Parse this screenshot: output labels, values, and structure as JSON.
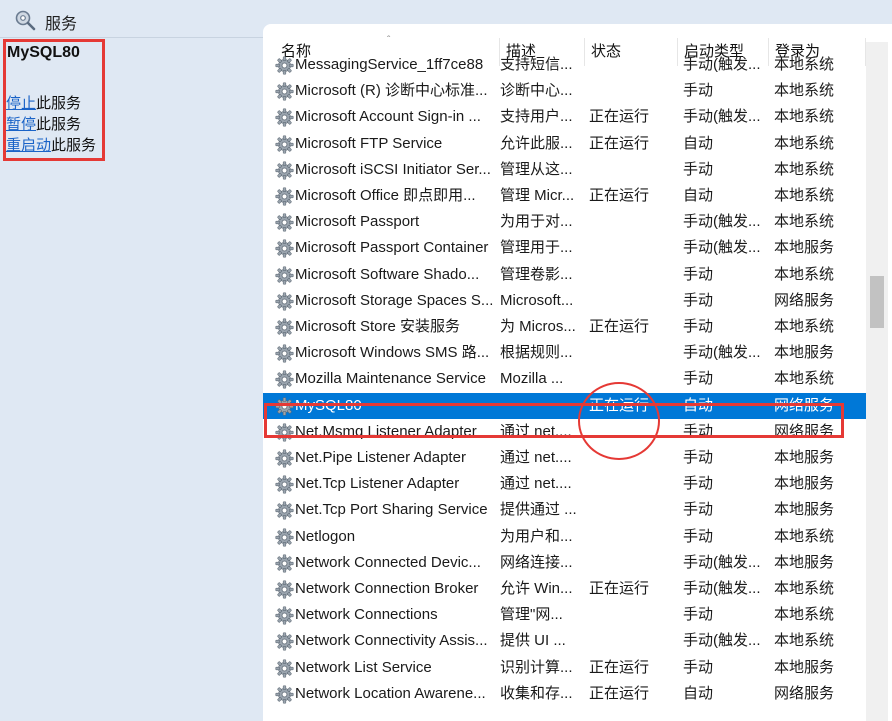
{
  "window": {
    "title": "服务",
    "title_icon": "magnifier-gear-icon"
  },
  "detail": {
    "service_name": "MySQL80",
    "actions": [
      {
        "link": "停止",
        "suffix": "此服务"
      },
      {
        "link": "暂停",
        "suffix": "此服务"
      },
      {
        "link": "重启动",
        "suffix": "此服务"
      }
    ]
  },
  "columns": {
    "name": "名称",
    "desc": "描述",
    "status": "状态",
    "start": "启动类型",
    "logon": "登录为"
  },
  "colors": {
    "selection": "#0078d7",
    "annotation_red": "#e53935",
    "link": "#1a63c7",
    "pane_bg": "#dfe8f3"
  },
  "services": [
    {
      "name": "MessagingService_1ff7ce88",
      "desc": "支持短信...",
      "status": "",
      "start": "手动(触发...",
      "logon": "本地系统"
    },
    {
      "name": "Microsoft (R) 诊断中心标准...",
      "desc": "诊断中心...",
      "status": "",
      "start": "手动",
      "logon": "本地系统"
    },
    {
      "name": "Microsoft Account Sign-in ...",
      "desc": "支持用户...",
      "status": "正在运行",
      "start": "手动(触发...",
      "logon": "本地系统"
    },
    {
      "name": "Microsoft FTP Service",
      "desc": "允许此服...",
      "status": "正在运行",
      "start": "自动",
      "logon": "本地系统"
    },
    {
      "name": "Microsoft iSCSI Initiator Ser...",
      "desc": "管理从这...",
      "status": "",
      "start": "手动",
      "logon": "本地系统"
    },
    {
      "name": "Microsoft Office 即点即用...",
      "desc": "管理 Micr...",
      "status": "正在运行",
      "start": "自动",
      "logon": "本地系统"
    },
    {
      "name": "Microsoft Passport",
      "desc": "为用于对...",
      "status": "",
      "start": "手动(触发...",
      "logon": "本地系统"
    },
    {
      "name": "Microsoft Passport Container",
      "desc": "管理用于...",
      "status": "",
      "start": "手动(触发...",
      "logon": "本地服务"
    },
    {
      "name": "Microsoft Software Shado...",
      "desc": "管理卷影...",
      "status": "",
      "start": "手动",
      "logon": "本地系统"
    },
    {
      "name": "Microsoft Storage Spaces S...",
      "desc": "Microsoft...",
      "status": "",
      "start": "手动",
      "logon": "网络服务"
    },
    {
      "name": "Microsoft Store 安装服务",
      "desc": "为 Micros...",
      "status": "正在运行",
      "start": "手动",
      "logon": "本地系统"
    },
    {
      "name": "Microsoft Windows SMS 路...",
      "desc": "根据规则...",
      "status": "",
      "start": "手动(触发...",
      "logon": "本地服务"
    },
    {
      "name": "Mozilla Maintenance Service",
      "desc": "Mozilla ...",
      "status": "",
      "start": "手动",
      "logon": "本地系统"
    },
    {
      "name": "MySQL80",
      "desc": "",
      "status": "正在运行",
      "start": "自动",
      "logon": "网络服务",
      "selected": true
    },
    {
      "name": "Net.Msmq Listener Adapter",
      "desc": "通过 net....",
      "status": "",
      "start": "手动",
      "logon": "网络服务"
    },
    {
      "name": "Net.Pipe Listener Adapter",
      "desc": "通过 net....",
      "status": "",
      "start": "手动",
      "logon": "本地服务"
    },
    {
      "name": "Net.Tcp Listener Adapter",
      "desc": "通过 net....",
      "status": "",
      "start": "手动",
      "logon": "本地服务"
    },
    {
      "name": "Net.Tcp Port Sharing Service",
      "desc": "提供通过 ...",
      "status": "",
      "start": "手动",
      "logon": "本地服务"
    },
    {
      "name": "Netlogon",
      "desc": "为用户和...",
      "status": "",
      "start": "手动",
      "logon": "本地系统"
    },
    {
      "name": "Network Connected Devic...",
      "desc": "网络连接...",
      "status": "",
      "start": "手动(触发...",
      "logon": "本地服务"
    },
    {
      "name": "Network Connection Broker",
      "desc": "允许 Win...",
      "status": "正在运行",
      "start": "手动(触发...",
      "logon": "本地系统"
    },
    {
      "name": "Network Connections",
      "desc": "管理\"网...",
      "status": "",
      "start": "手动",
      "logon": "本地系统"
    },
    {
      "name": "Network Connectivity Assis...",
      "desc": "提供 UI ...",
      "status": "",
      "start": "手动(触发...",
      "logon": "本地系统"
    },
    {
      "name": "Network List Service",
      "desc": "识别计算...",
      "status": "正在运行",
      "start": "手动",
      "logon": "本地服务"
    },
    {
      "name": "Network Location Awarene...",
      "desc": "收集和存...",
      "status": "正在运行",
      "start": "自动",
      "logon": "网络服务"
    }
  ]
}
